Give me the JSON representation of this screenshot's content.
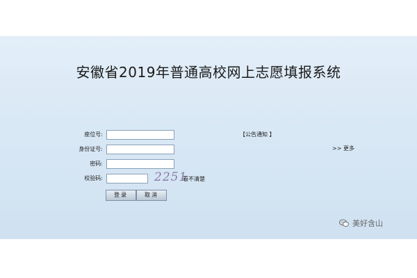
{
  "page": {
    "title": "安徽省2019年普通高校网上志愿填报系统"
  },
  "form": {
    "seat_label": "座位号:",
    "id_label": "身份证号:",
    "password_label": "密码:",
    "code_label": "校验码:",
    "seat_value": "",
    "id_value": "",
    "password_value": "",
    "code_value": "",
    "captcha_text": "2251",
    "captcha_help": "看不清楚",
    "login_label": "登录",
    "cancel_label": "取消"
  },
  "notice": {
    "label": "【公告通知 】",
    "more_label": ">> 更多"
  },
  "watermark": {
    "text": "美好含山",
    "icon": "wechat-icon"
  }
}
